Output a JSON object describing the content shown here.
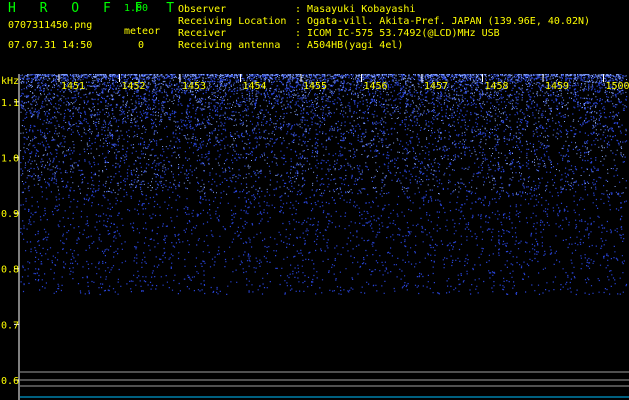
{
  "app": {
    "title": "H R O F F T",
    "version": "1.00",
    "filename": "0707311450.png",
    "datetime": "07.07.31 14:50",
    "meteor_label": "meteor",
    "meteor_count": "0"
  },
  "info": [
    {
      "label": "Observer",
      "value": "Masayuki Kobayashi"
    },
    {
      "label": "Receiving Location",
      "value": "Ogata-vill. Akita-Pref. JAPAN (139.96E, 40.02N)"
    },
    {
      "label": "Receiver",
      "value": "ICOM IC-575 53.7492(@LCD)MHz USB"
    },
    {
      "label": "Receiving antenna",
      "value": "A504HB(yagi 4el)"
    }
  ],
  "colors": {
    "background": "#000000",
    "title_green": "#00ff00",
    "text_yellow": "#ffff00",
    "signal_blue": "#3050ff",
    "baseline_cyan": "#00c0ff",
    "line_gray": "#a0a0a0"
  },
  "chart_data": {
    "type": "heatmap",
    "y_unit": "kHz",
    "x_ticks": [
      "1451",
      "1452",
      "1453",
      "1454",
      "1455",
      "1456",
      "1457",
      "1458",
      "1459",
      "1500"
    ],
    "y_ticks": [
      "1.1",
      "1.0",
      "0.9",
      "0.8",
      "0.7",
      "0.6"
    ],
    "y_values": [
      1.1,
      1.0,
      0.9,
      0.8,
      0.7,
      0.6
    ],
    "ylim": [
      0.6,
      1.15
    ],
    "grid": false
  }
}
